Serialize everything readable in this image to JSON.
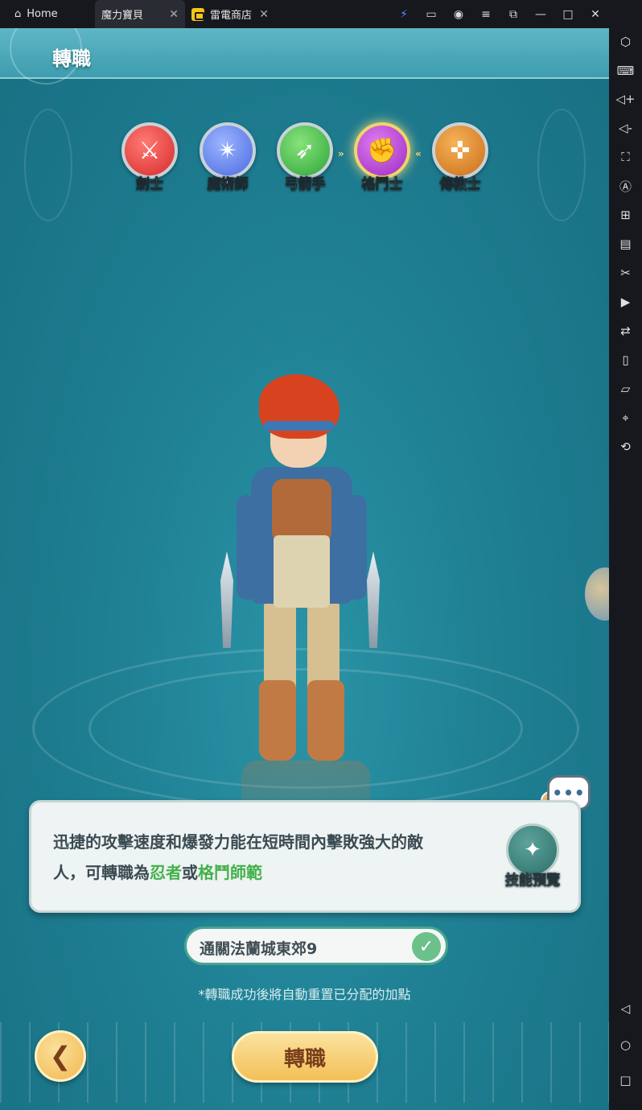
{
  "emulator": {
    "tabs": [
      {
        "label": "Home"
      },
      {
        "label": "魔力寶貝"
      },
      {
        "label": "雷電商店"
      }
    ],
    "close_glyph": "✕"
  },
  "game": {
    "title": "轉職",
    "classes": [
      {
        "name": "劍士",
        "icon": "sword-icon",
        "color": "#d52b2b"
      },
      {
        "name": "魔術師",
        "icon": "magic-icon",
        "color": "#4a6be0"
      },
      {
        "name": "弓箭手",
        "icon": "bow-icon",
        "color": "#2ea53a"
      },
      {
        "name": "格鬥士",
        "icon": "fist-icon",
        "color": "#9a2bc2",
        "selected": true
      },
      {
        "name": "傳教士",
        "icon": "priest-icon",
        "color": "#c96e1a"
      }
    ],
    "description": {
      "line1": "迅捷的攻擊速度和爆發力能在短時間內擊敗強大的敵",
      "line2_prefix": "人，可轉職為",
      "option1": "忍者",
      "connector": "或",
      "option2": "格鬥師範"
    },
    "skill_preview_label": "技能預覽",
    "chat_glyph": "•••",
    "condition": {
      "text": "通關法蘭城東郊9",
      "completed": true
    },
    "note": "*轉職成功後將自動重置已分配的加點",
    "confirm_label": "轉職",
    "colors": {
      "highlight": "#43b04a",
      "button": "#f3bf57",
      "background": "#1f7f93"
    }
  }
}
